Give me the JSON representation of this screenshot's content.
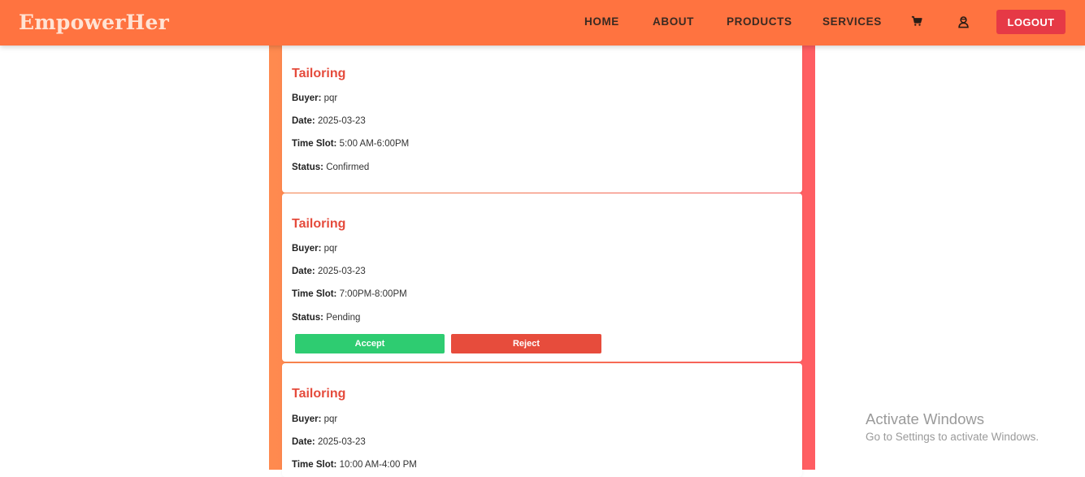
{
  "header": {
    "brand": "EmpowerHer",
    "nav": [
      "HOME",
      "ABOUT",
      "PRODUCTS",
      "SERVICES"
    ],
    "cart_icon": "cart-icon",
    "profile_icon": "user-icon",
    "logout_label": "LOGOUT"
  },
  "colors": {
    "navbar": "#ff7340",
    "accent_title": "#e54b3c",
    "accept": "#2ecc71",
    "reject": "#e74c3c",
    "logout": "#e63946"
  },
  "bookings": [
    {
      "service": "Tailoring",
      "buyer_label": "Buyer:",
      "buyer": "pqr",
      "date_label": "Date:",
      "date": "2025-03-23",
      "slot_label": "Time Slot:",
      "slot": "5:00 AM-6:00PM",
      "status_label": "Status:",
      "status": "Confirmed"
    },
    {
      "service": "Tailoring",
      "buyer_label": "Buyer:",
      "buyer": "pqr",
      "date_label": "Date:",
      "date": "2025-03-23",
      "slot_label": "Time Slot:",
      "slot": "7:00PM-8:00PM",
      "status_label": "Status:",
      "status": "Pending",
      "accept_label": "Accept",
      "reject_label": "Reject"
    },
    {
      "service": "Tailoring",
      "buyer_label": "Buyer:",
      "buyer": "pqr",
      "date_label": "Date:",
      "date": "2025-03-23",
      "slot_label": "Time Slot:",
      "slot": "10:00 AM-4:00 PM"
    }
  ],
  "watermark": {
    "title": "Activate Windows",
    "subtitle": "Go to Settings to activate Windows."
  }
}
